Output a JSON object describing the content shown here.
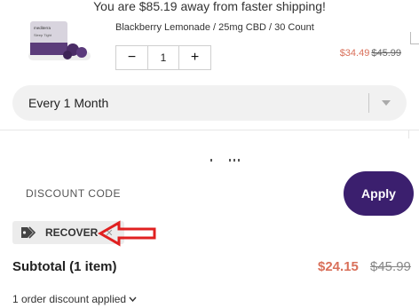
{
  "banner": {
    "text": "You are $85.19 away from faster shipping!"
  },
  "product": {
    "variant": "Blackberry Lemonade / 25mg CBD / 30 Count",
    "quantity": "1",
    "qty_minus": "−",
    "qty_plus": "+",
    "price_sale": "$34.49",
    "price_orig": "$45.99",
    "brand_label": "mediterra",
    "product_label": "Sleep Tight"
  },
  "subscription": {
    "frequency": "Every 1 Month"
  },
  "discount": {
    "label": "DISCOUNT CODE",
    "apply_label": "Apply",
    "applied_code": "RECOVER",
    "remove": "✕"
  },
  "summary": {
    "subtotal_label": "Subtotal (1 item)",
    "subtotal_sale": "$24.15",
    "subtotal_orig": "$45.99",
    "discount_applied": "1 order discount applied"
  },
  "colors": {
    "accent": "#3b1f6e",
    "sale": "#d9705a",
    "annotation": "#e02020"
  },
  "icons": {
    "tag": "tag-icon",
    "chevron": "chevron-down-icon",
    "remove": "close-icon",
    "annotation": "arrow-left-icon"
  }
}
